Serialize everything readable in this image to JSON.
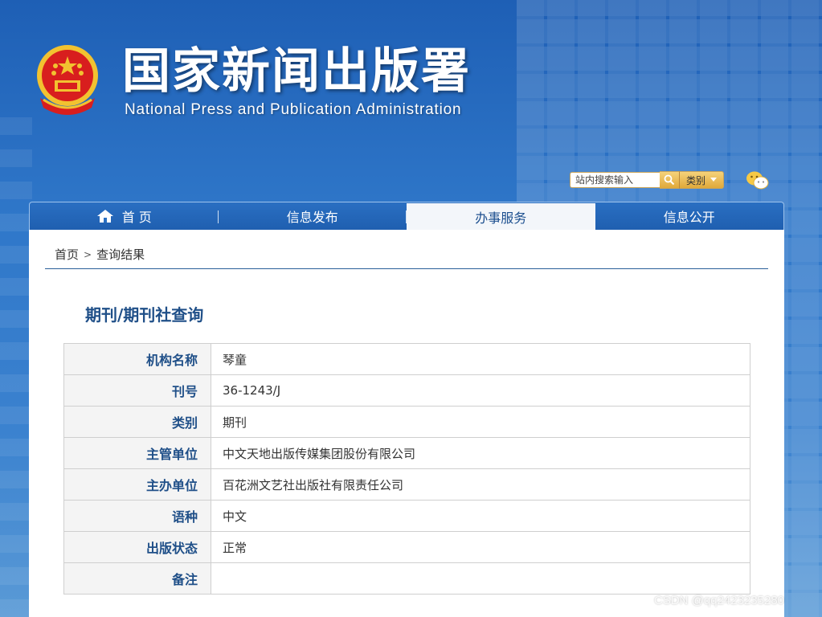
{
  "header": {
    "title_cn": "国家新闻出版署",
    "title_en": "National  Press and Publication Administration"
  },
  "search": {
    "placeholder": "站内搜索输入",
    "category_label": "类别"
  },
  "nav": {
    "items": [
      {
        "label": "首 页",
        "icon": "home-icon"
      },
      {
        "label": "信息发布"
      },
      {
        "label": "办事服务",
        "active": true
      },
      {
        "label": "信息公开"
      }
    ]
  },
  "breadcrumb": {
    "home": "首页",
    "sep": ">",
    "current": "查询结果"
  },
  "section": {
    "title": "期刊/期刊社查询"
  },
  "record": {
    "rows": [
      {
        "key": "机构名称",
        "value": "琴童"
      },
      {
        "key": "刊号",
        "value": "36-1243/J"
      },
      {
        "key": "类别",
        "value": "期刊"
      },
      {
        "key": "主管单位",
        "value": "中文天地出版传媒集团股份有限公司"
      },
      {
        "key": "主办单位",
        "value": "百花洲文艺社出版社有限责任公司"
      },
      {
        "key": "语种",
        "value": "中文"
      },
      {
        "key": "出版状态",
        "value": "正常"
      },
      {
        "key": "备注",
        "value": ""
      }
    ]
  },
  "watermark": "CSDN @qq2423235280",
  "colors": {
    "brand_blue": "#1f4f88",
    "nav_blue": "#2a6fc2",
    "search_gold": "#e0a93a",
    "emblem_red": "#d81e1e",
    "emblem_gold": "#f2c230"
  }
}
